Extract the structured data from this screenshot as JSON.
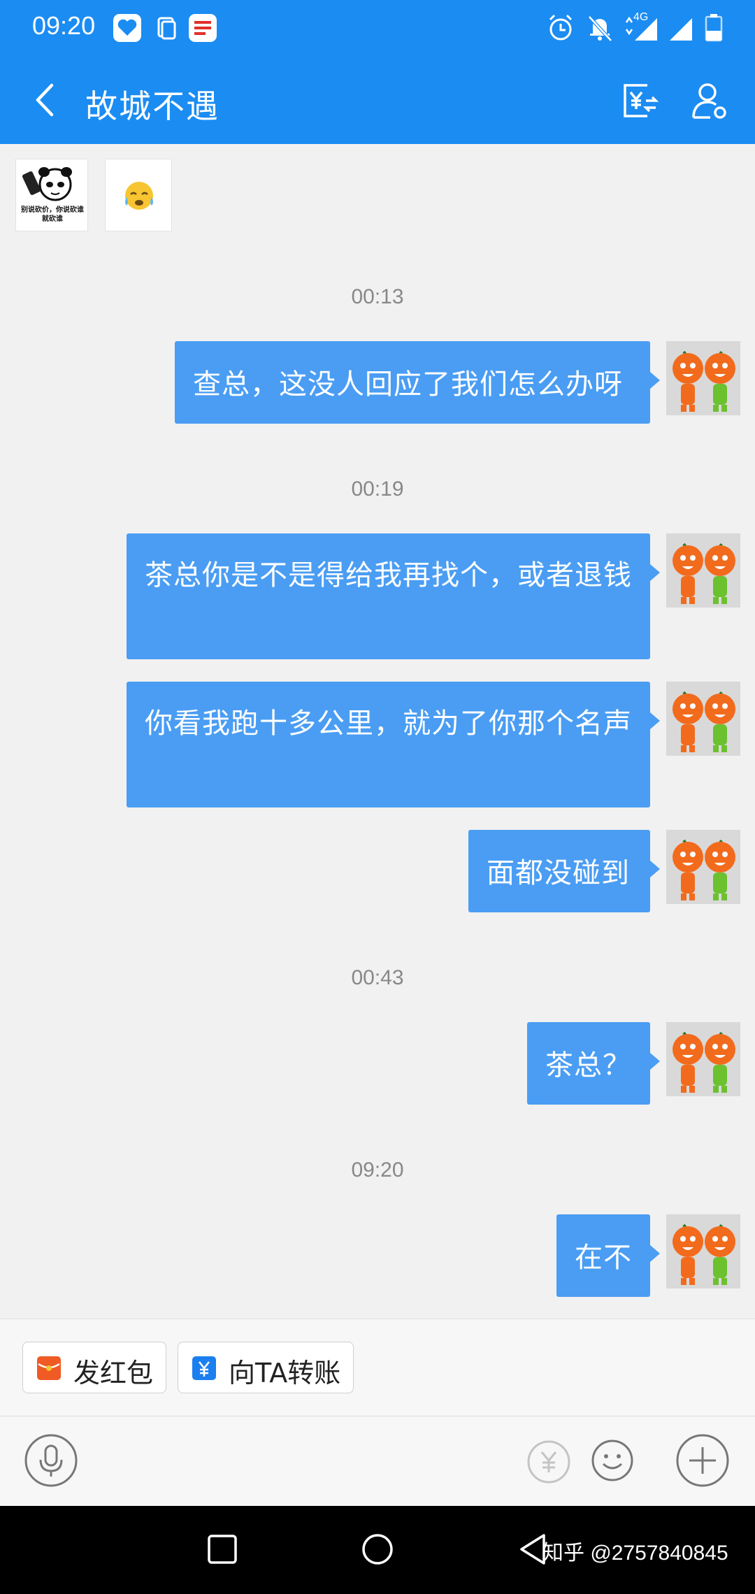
{
  "status_bar": {
    "time": "09:20",
    "network": "4G",
    "icons": [
      "alipay-app-icon",
      "files-app-icon",
      "notes-app-icon",
      "alarm-icon",
      "bell-off-icon",
      "signal-icon",
      "signal-icon",
      "battery-icon"
    ]
  },
  "header": {
    "title": "故城不遇",
    "back_icon": "chevron-left-icon",
    "actions": [
      "transfer-yuan-icon",
      "user-settings-icon"
    ]
  },
  "chat": {
    "top_sticker_text": "别说砍价，你说砍谁就砍谁",
    "groups": [
      {
        "time": "00:13",
        "messages": [
          "查总，这没人回应了我们怎么办呀"
        ]
      },
      {
        "time": "00:19",
        "messages": [
          "茶总你是不是得给我再找个，或者退钱",
          "你看我跑十多公里，就为了你那个名声",
          "面都没碰到"
        ]
      },
      {
        "time": "00:43",
        "messages": [
          "茶总？"
        ]
      },
      {
        "time": "09:20",
        "messages": [
          "在不"
        ]
      }
    ]
  },
  "quick_actions": {
    "red_packet": "发红包",
    "transfer": "向TA转账"
  },
  "input": {
    "value": "",
    "icons": [
      "microphone-icon",
      "yuan-coin-icon",
      "smiley-icon",
      "plus-icon"
    ]
  },
  "system_nav": {
    "watermark": "知乎 @2757840845"
  },
  "colors": {
    "accent": "#1b8cf2",
    "bubble": "#4a9df3",
    "background": "#f1f1f1",
    "red_packet": "#f05a24"
  }
}
